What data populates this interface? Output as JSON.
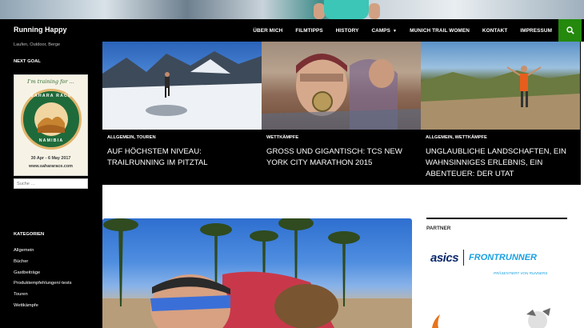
{
  "site": {
    "title": "Running Happy",
    "description": "Laufen, Outdoor, Berge"
  },
  "nav": {
    "items": [
      {
        "label": "ÜBER MICH"
      },
      {
        "label": "FILMTIPPS"
      },
      {
        "label": "HISTORY"
      },
      {
        "label": "CAMPS"
      },
      {
        "label": "MUNICH TRAIL WOMEN"
      },
      {
        "label": "KONTAKT"
      },
      {
        "label": "IMPRESSUM"
      }
    ],
    "dropdown_icon": "chevron-down-icon",
    "search_icon": "search-icon",
    "search_color": "#24890d"
  },
  "sidebar": {
    "next_goal_title": "NEXT GOAL",
    "badge": {
      "top_text": "I'm training for ...",
      "ring_top": "SAHARA RACE",
      "ring_bottom": "NAMIBIA",
      "dates": "30 Apr - 6 May 2017",
      "url": "www.sahararace.com"
    },
    "search_placeholder": "Suche …",
    "categories_title": "KATEGORIEN",
    "categories": [
      "Allgemein",
      "Bücher",
      "Gastbeiträge",
      "Produktempfehlungen/-tests",
      "Touren",
      "Wettkämpfe"
    ]
  },
  "featured": [
    {
      "category": "ALLGEMEIN, TOUREN",
      "title": "AUF HÖCHSTEM NIVEAU: TRAILRUNNING IM PITZTAL"
    },
    {
      "category": "WETTKÄMPFE",
      "title": "GROSS UND GIGANTISCH: TCS NEW YORK CITY MARATHON 2015"
    },
    {
      "category": "ALLGEMEIN, WETTKÄMPFE",
      "title": "UNGLAUBLICHE LANDSCHAFTEN, EIN WAHNSINNIGES ERLEBNIS, EIN ABENTEUER: DER UTAT"
    }
  ],
  "right_sidebar": {
    "partner_title": "PARTNER",
    "asics": "asics",
    "frontrunner": "FRONTRUNNER",
    "presented_by": "PRÄSENTIERT VON RUNNERS"
  }
}
